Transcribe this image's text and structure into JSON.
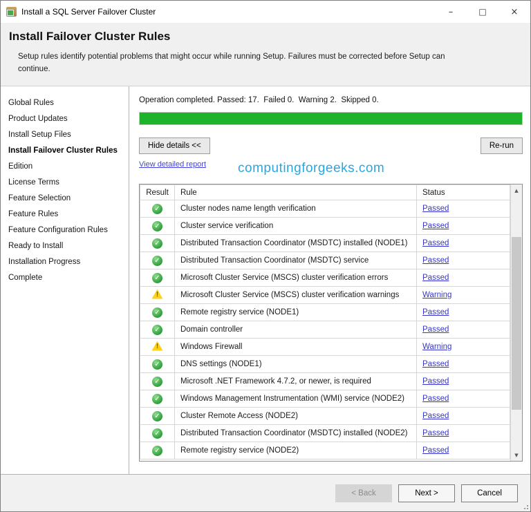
{
  "window": {
    "title": "Install a SQL Server Failover Cluster",
    "controls": {
      "minimize": "–",
      "maximize": "□",
      "close": "×"
    }
  },
  "header": {
    "title": "Install Failover Cluster Rules",
    "description": "Setup rules identify potential problems that might occur while running Setup. Failures must be corrected before Setup can continue."
  },
  "sidebar": {
    "items": [
      {
        "label": "Global Rules",
        "active": false
      },
      {
        "label": "Product Updates",
        "active": false
      },
      {
        "label": "Install Setup Files",
        "active": false
      },
      {
        "label": "Install Failover Cluster Rules",
        "active": true
      },
      {
        "label": "Edition",
        "active": false
      },
      {
        "label": "License Terms",
        "active": false
      },
      {
        "label": "Feature Selection",
        "active": false
      },
      {
        "label": "Feature Rules",
        "active": false
      },
      {
        "label": "Feature Configuration Rules",
        "active": false
      },
      {
        "label": "Ready to Install",
        "active": false
      },
      {
        "label": "Installation Progress",
        "active": false
      },
      {
        "label": "Complete",
        "active": false
      }
    ]
  },
  "main": {
    "status_line": "Operation completed. Passed: 17.  Failed 0.  Warning 2.  Skipped 0.",
    "progress_percent": 100,
    "hide_details_label": "Hide details <<",
    "rerun_label": "Re-run",
    "report_link": "View detailed report",
    "watermark": "computingforgeeks.com",
    "table": {
      "columns": [
        "Result",
        "Rule",
        "Status"
      ],
      "rows": [
        {
          "result": "passed",
          "rule": "Cluster nodes name length verification",
          "status": "Passed"
        },
        {
          "result": "passed",
          "rule": "Cluster service verification",
          "status": "Passed"
        },
        {
          "result": "passed",
          "rule": "Distributed Transaction Coordinator (MSDTC) installed (NODE1)",
          "status": "Passed"
        },
        {
          "result": "passed",
          "rule": "Distributed Transaction Coordinator (MSDTC) service",
          "status": "Passed"
        },
        {
          "result": "passed",
          "rule": "Microsoft Cluster Service (MSCS) cluster verification errors",
          "status": "Passed"
        },
        {
          "result": "warning",
          "rule": "Microsoft Cluster Service (MSCS) cluster verification warnings",
          "status": "Warning"
        },
        {
          "result": "passed",
          "rule": "Remote registry service (NODE1)",
          "status": "Passed"
        },
        {
          "result": "passed",
          "rule": "Domain controller",
          "status": "Passed"
        },
        {
          "result": "warning",
          "rule": "Windows Firewall",
          "status": "Warning"
        },
        {
          "result": "passed",
          "rule": "DNS settings (NODE1)",
          "status": "Passed"
        },
        {
          "result": "passed",
          "rule": "Microsoft .NET Framework 4.7.2, or newer, is required",
          "status": "Passed"
        },
        {
          "result": "passed",
          "rule": "Windows Management Instrumentation (WMI) service (NODE2)",
          "status": "Passed"
        },
        {
          "result": "passed",
          "rule": "Cluster Remote Access (NODE2)",
          "status": "Passed"
        },
        {
          "result": "passed",
          "rule": "Distributed Transaction Coordinator (MSDTC) installed (NODE2)",
          "status": "Passed"
        },
        {
          "result": "passed",
          "rule": "Remote registry service (NODE2)",
          "status": "Passed"
        }
      ]
    }
  },
  "footer": {
    "back_label": "< Back",
    "next_label": "Next >",
    "cancel_label": "Cancel"
  },
  "colors": {
    "progress_green": "#1db32a",
    "link_blue": "#3434cd",
    "report_link_blue": "#4343d6",
    "watermark_blue": "#2ba6e0",
    "warning_yellow": "#fdd21a",
    "passed_green": "#2f9e3a",
    "header_gray": "#f0f0f0"
  }
}
